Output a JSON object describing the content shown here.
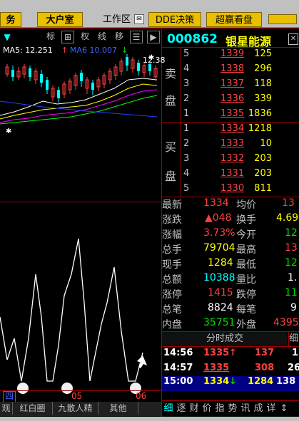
{
  "toolbar": {
    "btn_fu": "务",
    "btn_dahushi": "大户室",
    "label_gongzuoqu": "工作区",
    "btn_dde": "DDE决策",
    "btn_chaoying": "超赢看盘",
    "icon_box": "✉"
  },
  "chart_tools": [
    "标",
    "⊞",
    "权",
    "线",
    "移",
    "☰"
  ],
  "chart_tool_icons": [
    "◀",
    "▶"
  ],
  "ma_labels": {
    "ma5": "MA5: 12.251",
    "ma10": "MA6  10.007",
    "up_arrow": "↑",
    "down_arrow": "↓",
    "price_tag": "12.38"
  },
  "stock": {
    "code": "000862",
    "name": "银星能源"
  },
  "sell_label": [
    "卖",
    "盘"
  ],
  "buy_label": [
    "买",
    "盘"
  ],
  "sell_book": [
    {
      "level": "5",
      "price": "1339",
      "vol": "125"
    },
    {
      "level": "4",
      "price": "1338",
      "vol": "296"
    },
    {
      "level": "3",
      "price": "1337",
      "vol": "118"
    },
    {
      "level": "2",
      "price": "1336",
      "vol": "339"
    },
    {
      "level": "1",
      "price": "1335",
      "vol": "1836"
    }
  ],
  "buy_book": [
    {
      "level": "1",
      "price": "1334",
      "vol": "1218"
    },
    {
      "level": "2",
      "price": "1333",
      "vol": "10"
    },
    {
      "level": "3",
      "price": "1332",
      "vol": "203"
    },
    {
      "level": "4",
      "price": "1331",
      "vol": "203"
    },
    {
      "level": "5",
      "price": "1330",
      "vol": "811"
    }
  ],
  "quotes": [
    {
      "l1": "最新",
      "v1": "1334",
      "l2": "均价",
      "v2": "13",
      "c1": "red",
      "c2": "red"
    },
    {
      "l1": "涨跌",
      "v1": "▲048",
      "l2": "换手",
      "v2": "4.69",
      "c1": "red",
      "c2": "yellow"
    },
    {
      "l1": "涨幅",
      "v1": "3.73%",
      "l2": "今开",
      "v2": "12",
      "c1": "red",
      "c2": "green"
    },
    {
      "l1": "总手",
      "v1": "79704",
      "l2": "最高",
      "v2": "13",
      "c1": "yellow",
      "c2": "red"
    },
    {
      "l1": "现手",
      "v1": "1284",
      "l2": "最低",
      "v2": "12",
      "c1": "yellow",
      "c2": "green"
    },
    {
      "l1": "总额",
      "v1": "10388",
      "l2": "量比",
      "v2": "1.",
      "c1": "cyan",
      "c2": "white"
    },
    {
      "l1": "涨停",
      "v1": "1415",
      "l2": "跌停",
      "v2": "11",
      "c1": "red",
      "c2": "green"
    },
    {
      "l1": "总笔",
      "v1": "8824",
      "l2": "每笔",
      "v2": "9",
      "c1": "white",
      "c2": "white"
    },
    {
      "l1": "内盘",
      "v1": "35751",
      "l2": "外盘",
      "v2": "4395",
      "c1": "green",
      "c2": "red"
    }
  ],
  "trades_header": "分时成交",
  "trades_header2": "细",
  "trades": [
    {
      "time": "14:56",
      "price": "1335",
      "arrow": "↑",
      "vol": "137",
      "n": "1"
    },
    {
      "time": "14:57",
      "price": "1335",
      "arrow": "",
      "vol": "308",
      "n": "26"
    },
    {
      "time": "15:00",
      "price": "1334",
      "arrow": "↓",
      "vol": "1284",
      "n": "138"
    }
  ],
  "bottom_tabs": [
    "观",
    "红白圈",
    "九散人精",
    "其他"
  ],
  "right_tabs": [
    "细",
    "逐",
    "财",
    "价",
    "指",
    "势",
    "讯",
    "成",
    "详",
    "↕"
  ],
  "timeline": {
    "label_a": "四",
    "label_b": "05",
    "label_c": "06"
  },
  "colors": {
    "toolbar_bg": "#c0c0c0",
    "button_yellow": "#e8c000",
    "up_red": "#ff4040",
    "down_green": "#00e000",
    "stock_code_cyan": "#00ffff",
    "divider_red": "#a00000"
  }
}
